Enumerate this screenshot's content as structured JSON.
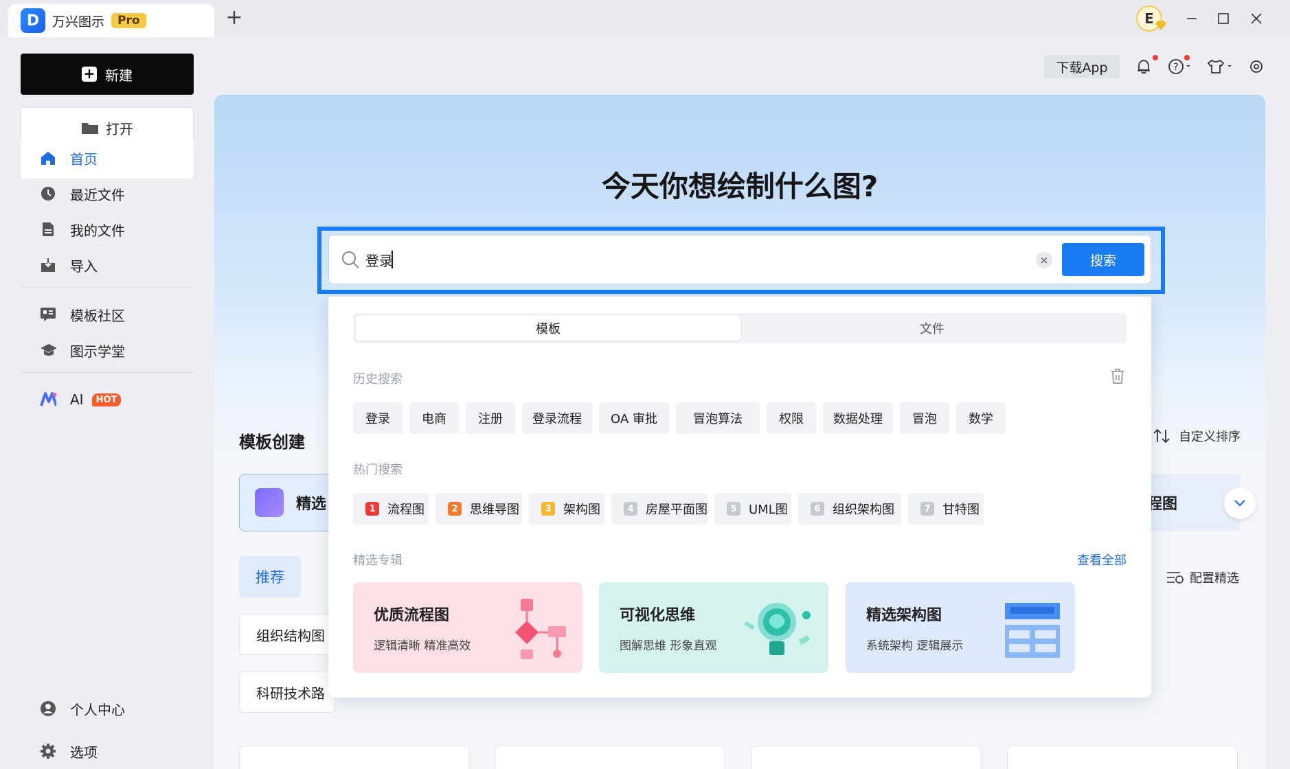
{
  "titlebar": {
    "app_name": "万兴图示",
    "pro_badge": "Pro",
    "new_tab": "+",
    "avatar_letter": "E"
  },
  "sidebar": {
    "new_label": "新建",
    "open_label": "打开",
    "nav": [
      {
        "label": "首页",
        "icon": "home-icon"
      },
      {
        "label": "最近文件",
        "icon": "clock-icon"
      },
      {
        "label": "我的文件",
        "icon": "file-icon"
      },
      {
        "label": "导入",
        "icon": "import-icon"
      },
      {
        "label": "模板社区",
        "icon": "template-community-icon"
      },
      {
        "label": "图示学堂",
        "icon": "graduation-cap-icon"
      },
      {
        "label": "AI",
        "icon": "ai-logo-icon",
        "badge": "HOT"
      },
      {
        "label": "个人中心",
        "icon": "user-icon"
      },
      {
        "label": "选项",
        "icon": "gear-icon"
      }
    ]
  },
  "topbar": {
    "download_app": "下载App"
  },
  "hero": {
    "title": "今天你想绘制什么图?"
  },
  "search": {
    "value": "登录",
    "clear": "×",
    "button": "搜索"
  },
  "dropdown": {
    "tabs": [
      "模板",
      "文件"
    ],
    "history_label": "历史搜索",
    "history": [
      "登录",
      "电商",
      "注册",
      "登录流程",
      "OA 审批",
      "冒泡算法",
      "权限",
      "数据处理",
      "冒泡",
      "数学"
    ],
    "hot_label": "热门搜索",
    "hot": [
      {
        "rank": "1",
        "label": "流程图",
        "color": "#f03a3a"
      },
      {
        "rank": "2",
        "label": "思维导图",
        "color": "#f47a2a"
      },
      {
        "rank": "3",
        "label": "架构图",
        "color": "#f5b82e"
      },
      {
        "rank": "4",
        "label": "房屋平面图",
        "color": "#c4c8cf"
      },
      {
        "rank": "5",
        "label": "UML图",
        "color": "#c4c8cf"
      },
      {
        "rank": "6",
        "label": "组织架构图",
        "color": "#c4c8cf"
      },
      {
        "rank": "7",
        "label": "甘特图",
        "color": "#c4c8cf"
      }
    ],
    "featured_label": "精选专辑",
    "view_all": "查看全部",
    "featured": [
      {
        "title": "优质流程图",
        "subtitle": "逻辑清晰 精准高效",
        "bg": "#fde0e6"
      },
      {
        "title": "可视化思维",
        "subtitle": "图解思维 形象直观",
        "bg": "#d4f2ee"
      },
      {
        "title": "精选架构图",
        "subtitle": "系统架构 逻辑展示",
        "bg": "#dde9fb"
      }
    ]
  },
  "main": {
    "section_title": "模板创建",
    "sort_label": "自定义排序",
    "config_label": "配置精选",
    "cat_left": "精选",
    "cat_right": "程图",
    "recommend": "推荐",
    "tags_row1": [
      "组织结构图"
    ],
    "tags_row2": [
      "科研技术路"
    ]
  }
}
